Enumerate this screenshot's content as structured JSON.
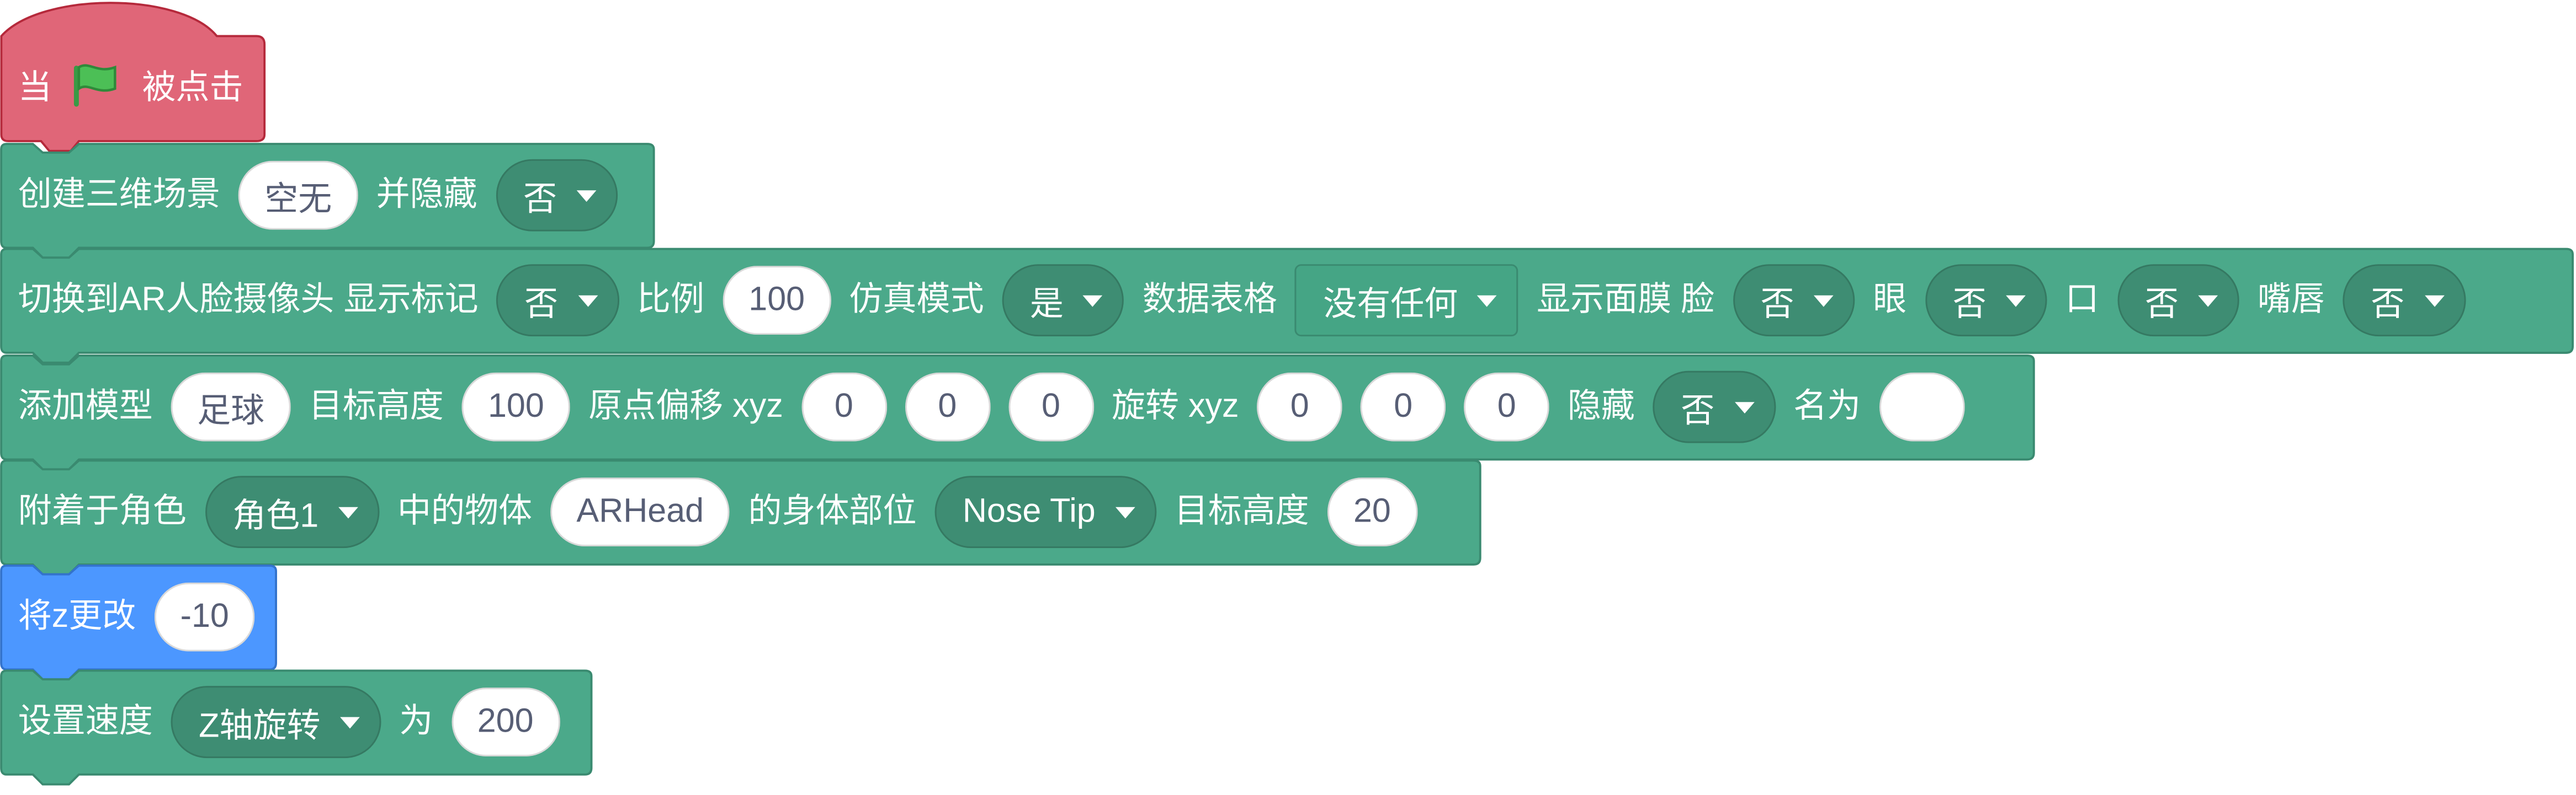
{
  "colors": {
    "hat": "#e06678",
    "hat_stroke": "#b5293b",
    "ext": "#4ba98a",
    "ext_stroke": "#3a8a70",
    "motion": "#4c97ff",
    "motion_stroke": "#3373cc",
    "flag": "#4cbf56"
  },
  "hat": {
    "when": "当",
    "clicked": "被点击"
  },
  "create_scene": {
    "label": "创建三维场景",
    "value": "空无",
    "hide_label": "并隐藏",
    "hide_value": "否"
  },
  "ar_camera": {
    "label": "切换到AR人脸摄像头 显示标记",
    "marker_value": "否",
    "scale_label": "比例",
    "scale_value": "100",
    "sim_label": "仿真模式",
    "sim_value": "是",
    "table_label": "数据表格",
    "table_value": "没有任何",
    "mask_label": "显示面膜 脸",
    "face_value": "否",
    "eye_label": "眼",
    "eye_value": "否",
    "mouth_label": "口",
    "mouth_value": "否",
    "lips_label": "嘴唇",
    "lips_value": "否"
  },
  "add_model": {
    "label": "添加模型",
    "model": "足球",
    "height_label": "目标高度",
    "height": "100",
    "offset_label": "原点偏移 xyz",
    "ox": "0",
    "oy": "0",
    "oz": "0",
    "rot_label": "旋转 xyz",
    "rx": "0",
    "ry": "0",
    "rz": "0",
    "hide_label": "隐藏",
    "hide_value": "否",
    "name_label": "名为",
    "name_value": ""
  },
  "attach": {
    "label": "附着于角色",
    "sprite": "角色1",
    "obj_label": "中的物体",
    "obj": "ARHead",
    "part_label": "的身体部位",
    "part": "Nose Tip",
    "height_label": "目标高度",
    "height": "20"
  },
  "change_z": {
    "label": "将z更改",
    "value": "-10"
  },
  "set_speed": {
    "label": "设置速度",
    "axis": "Z轴旋转",
    "to_label": "为",
    "value": "200"
  }
}
